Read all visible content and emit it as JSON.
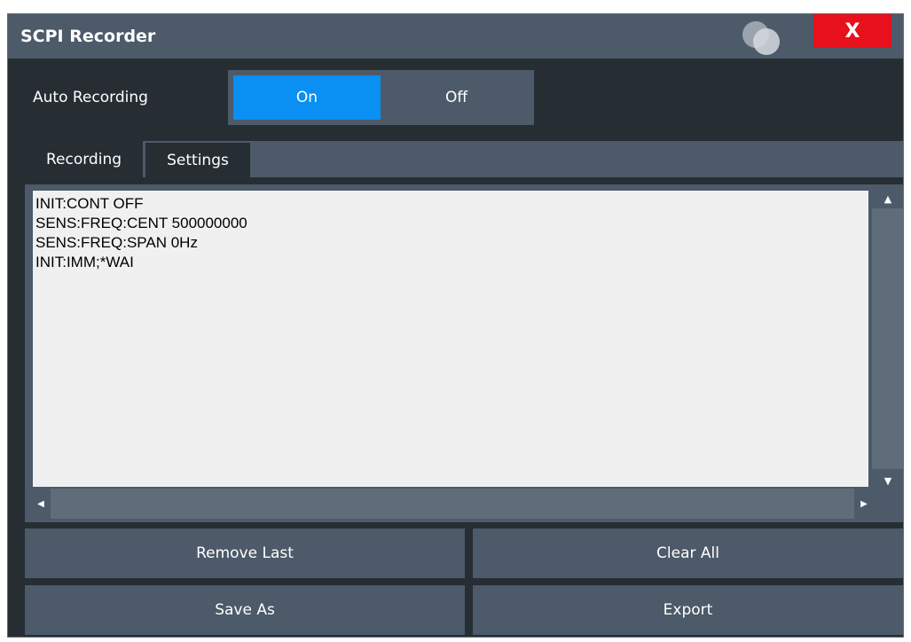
{
  "window": {
    "title": "SCPI Recorder",
    "close_label": "X",
    "close_color": "#e8101c"
  },
  "auto_recording": {
    "label": "Auto Recording",
    "on_label": "On",
    "off_label": "Off",
    "selected": "On",
    "accent_color": "#0a8ff2"
  },
  "tabs": [
    {
      "label": "Recording",
      "active": true
    },
    {
      "label": "Settings",
      "active": false
    }
  ],
  "recording": {
    "lines": [
      "INIT:CONT OFF",
      "SENS:FREQ:CENT 500000000",
      "SENS:FREQ:SPAN 0Hz",
      "INIT:IMM;*WAI"
    ]
  },
  "buttons": {
    "remove_last": "Remove Last",
    "clear_all": "Clear All",
    "save_as": "Save As",
    "export": "Export"
  },
  "icons": {
    "window_icon": "overlapping-circles-icon",
    "scroll_up": "arrow-up-icon",
    "scroll_down": "arrow-down-icon",
    "scroll_left": "arrow-left-icon",
    "scroll_right": "arrow-right-icon"
  }
}
